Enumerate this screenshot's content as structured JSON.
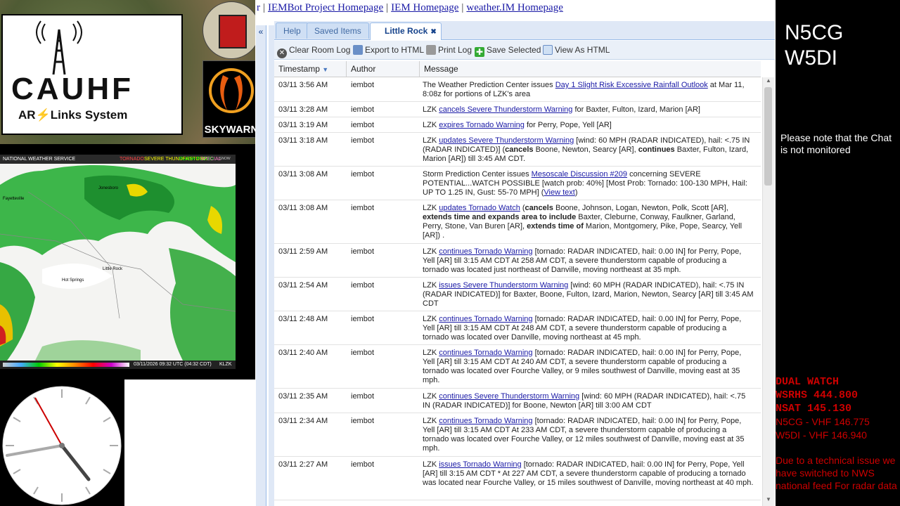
{
  "header_links": [
    "r",
    "IEMBot Project Homepage",
    "IEM Homepage",
    "weather.IM Homepage"
  ],
  "logo": {
    "title": "CAUHF",
    "sub_left": "AR",
    "sub_right": "Links System"
  },
  "skywarn_label": "SKYWARN",
  "radar": {
    "header": "NATIONAL WEATHER SERVICE",
    "legend": [
      "TORNADO",
      "SEVERE THUNDERSTORM",
      "FLASH FLOOD",
      "SPECIAL MARINE",
      "SNOW SQUALL"
    ],
    "cities": [
      "Fayetteville",
      "Little Rock",
      "Hot Springs",
      "Jonesboro"
    ],
    "footer_timestamp": "03/11/2026 09:32 UTC (04:32 CDT)",
    "station": "KLZK"
  },
  "tabs": [
    {
      "label": "Help"
    },
    {
      "label": "Saved Items"
    },
    {
      "label": "Little Rock"
    }
  ],
  "toolbar": {
    "clear": "Clear Room Log",
    "export": "Export to HTML",
    "print": "Print Log",
    "save": "Save Selected",
    "view": "View As HTML"
  },
  "columns": {
    "timestamp": "Timestamp",
    "author": "Author",
    "message": "Message"
  },
  "rows": [
    {
      "ts": "03/11 3:56 AM",
      "author": "iembot"
    },
    {
      "ts": "03/11 3:28 AM",
      "author": "iembot"
    },
    {
      "ts": "03/11 3:19 AM",
      "author": "iembot"
    },
    {
      "ts": "03/11 3:18 AM",
      "author": "iembot"
    },
    {
      "ts": "03/11 3:08 AM",
      "author": "iembot"
    },
    {
      "ts": "03/11 3:08 AM",
      "author": "iembot"
    },
    {
      "ts": "03/11 2:59 AM",
      "author": "iembot"
    },
    {
      "ts": "03/11 2:54 AM",
      "author": "iembot"
    },
    {
      "ts": "03/11 2:48 AM",
      "author": "iembot"
    },
    {
      "ts": "03/11 2:40 AM",
      "author": "iembot"
    },
    {
      "ts": "03/11 2:35 AM",
      "author": "iembot"
    },
    {
      "ts": "03/11 2:34 AM",
      "author": "iembot"
    },
    {
      "ts": "03/11 2:27 AM",
      "author": "iembot"
    }
  ],
  "msgs": {
    "m0a": "The Weather Prediction Center issues ",
    "m0l": "Day 1 Slight Risk Excessive Rainfall Outlook",
    "m0b": " at Mar 11, 8:08z for portions of LZK's area",
    "m1a": "LZK ",
    "m1l": "cancels Severe Thunderstorm Warning",
    "m1b": " for Baxter, Fulton, Izard, Marion [AR]",
    "m2a": "LZK ",
    "m2l": "expires Tornado Warning",
    "m2b": " for Perry, Pope, Yell [AR]",
    "m3a": "LZK ",
    "m3l": "updates Severe Thunderstorm Warning",
    "m3b": " [wind: 60 MPH (RADAR INDICATED), hail: <.75 IN (RADAR INDICATED)] (",
    "m3c": "cancels",
    "m3d": " Boone, Newton, Searcy [AR], ",
    "m3e": "continues",
    "m3f": " Baxter, Fulton, Izard, Marion [AR]) till 3:45 AM CDT.",
    "m4a": "Storm Prediction Center issues ",
    "m4l": "Mesoscale Discussion #209",
    "m4b": " concerning SEVERE POTENTIAL...WATCH POSSIBLE [watch prob: 40%] [Most Prob: Tornado: 100-130 MPH, Hail: UP TO 1.25 IN, Gust: 55-70 MPH] (",
    "m4l2": "View text",
    "m4c": ")",
    "m5a": "LZK ",
    "m5l": "updates Tornado Watch",
    "m5b": " (",
    "m5c": "cancels",
    "m5d": " Boone, Johnson, Logan, Newton, Polk, Scott [AR], ",
    "m5e": "extends time and expands area to include",
    "m5f": " Baxter, Cleburne, Conway, Faulkner, Garland, Perry, Stone, Van Buren [AR], ",
    "m5g": "extends time of",
    "m5h": " Marion, Montgomery, Pike, Pope, Searcy, Yell [AR]) .",
    "m6a": "LZK ",
    "m6l": "continues Tornado Warning",
    "m6b": " [tornado: RADAR INDICATED, hail: 0.00 IN] for Perry, Pope, Yell [AR] till 3:15 AM CDT At 258 AM CDT, a severe thunderstorm capable of producing a tornado was located just northeast of Danville, moving northeast at 35 mph.",
    "m7a": "LZK ",
    "m7l": "issues Severe Thunderstorm Warning",
    "m7b": " [wind: 60 MPH (RADAR INDICATED), hail: <.75 IN (RADAR INDICATED)] for Baxter, Boone, Fulton, Izard, Marion, Newton, Searcy [AR] till 3:45 AM CDT",
    "m8a": "LZK ",
    "m8l": "continues Tornado Warning",
    "m8b": " [tornado: RADAR INDICATED, hail: 0.00 IN] for Perry, Pope, Yell [AR] till 3:15 AM CDT At 248 AM CDT, a severe thunderstorm capable of producing a tornado was located over Danville, moving northeast at 45 mph.",
    "m9a": "LZK ",
    "m9l": "continues Tornado Warning",
    "m9b": " [tornado: RADAR INDICATED, hail: 0.00 IN] for Perry, Pope, Yell [AR] till 3:15 AM CDT At 240 AM CDT, a severe thunderstorm capable of producing a tornado was located over Fourche Valley, or 9 miles southwest of Danville, moving east at 35 mph.",
    "m10a": "LZK ",
    "m10l": "continues Severe Thunderstorm Warning",
    "m10b": " [wind: 60 MPH (RADAR INDICATED), hail: <.75 IN (RADAR INDICATED)] for Boone, Newton [AR] till 3:00 AM CDT",
    "m11a": "LZK ",
    "m11l": "continues Tornado Warning",
    "m11b": " [tornado: RADAR INDICATED, hail: 0.00 IN] for Perry, Pope, Yell [AR] till 3:15 AM CDT At 233 AM CDT, a severe thunderstorm capable of producing a tornado was located over Fourche Valley, or 12 miles southwest of Danville, moving east at 35 mph.",
    "m12a": "LZK ",
    "m12l": "issues Tornado Warning",
    "m12b": " [tornado: RADAR INDICATED, hail: 0.00 IN] for Perry, Pope, Yell [AR] till 3:15 AM CDT * At 227 AM CDT, a severe thunderstorm capable of producing a tornado was located near Fourche Valley, or 15 miles southwest of Danville, moving northeast at 40 mph."
  },
  "right": {
    "call1": "N5CG",
    "call2": "W5DI",
    "note": "Please note that the Chat is not monitored",
    "dual": [
      "DUAL WATCH",
      "WSRHS 444.800",
      "NSAT 145.130",
      "N5CG - VHF 146.775",
      "W5DI - VHF 146.940"
    ],
    "tech": "Due to a technical issue we have switched to NWS national feed For radar data"
  },
  "colors": {
    "link": "#1a1aa6",
    "accent_red": "#cc0000",
    "tab_blue": "#15428b"
  }
}
